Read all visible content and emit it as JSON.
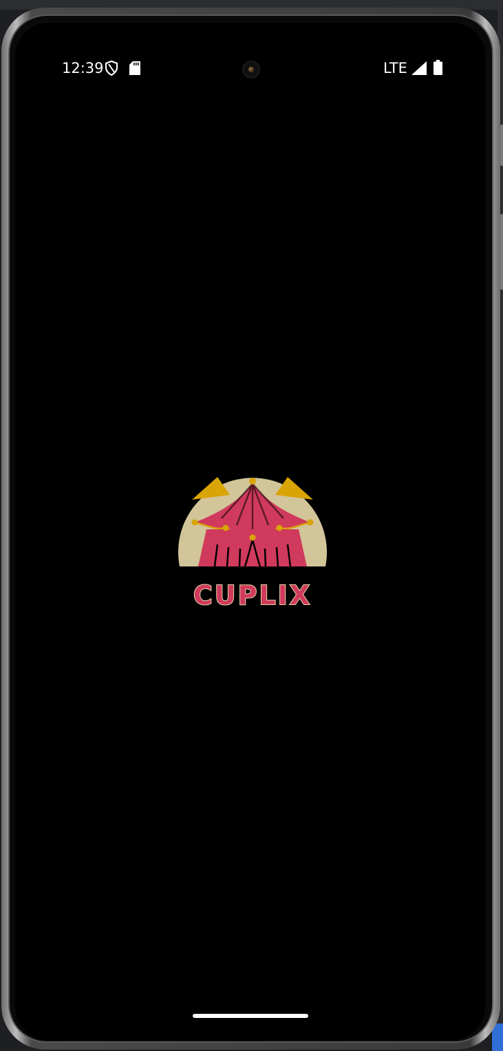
{
  "status_bar": {
    "time": "12:39",
    "network": "LTE",
    "icons": [
      "shield-icon",
      "sd-card-icon",
      "signal-icon",
      "battery-icon"
    ]
  },
  "splash": {
    "brand_name": "CUPLIX",
    "logo_icon": "circus-tent-icon",
    "colors": {
      "background": "#000000",
      "logo_sun": "#d2c59a",
      "logo_tent": "#d03a5c",
      "logo_accent": "#d9a406",
      "text": "#d03a5c"
    }
  }
}
